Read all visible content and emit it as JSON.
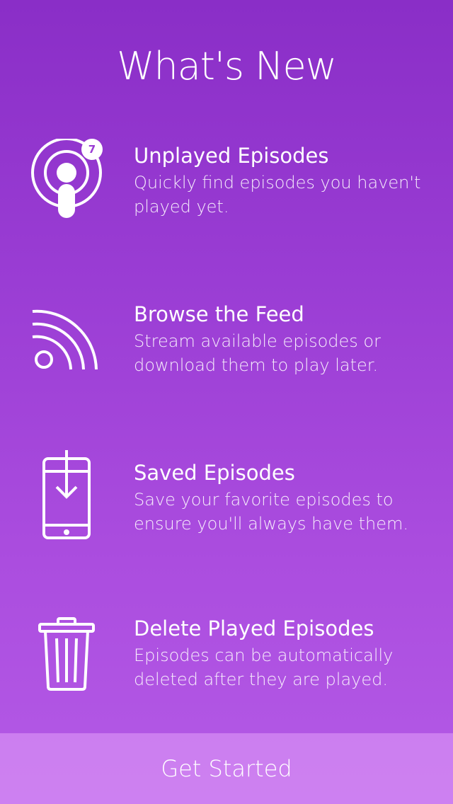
{
  "title": "What's New",
  "features": [
    {
      "icon": "podcast-icon",
      "badge": "7",
      "heading": "Unplayed Episodes",
      "description": "Quickly find episodes you haven't played yet."
    },
    {
      "icon": "feed-icon",
      "heading": "Browse the Feed",
      "description": "Stream available episodes or download them to play later."
    },
    {
      "icon": "phone-download-icon",
      "heading": "Saved Episodes",
      "description": "Save your favorite episodes to ensure you'll always have them."
    },
    {
      "icon": "trash-icon",
      "heading": "Delete Played Episodes",
      "description": "Episodes can be automatically deleted after they are played."
    }
  ],
  "cta": {
    "label": "Get Started"
  },
  "colors": {
    "background_top": "#8a2ec7",
    "background_bottom": "#b45ae6",
    "foreground": "#ffffff"
  }
}
